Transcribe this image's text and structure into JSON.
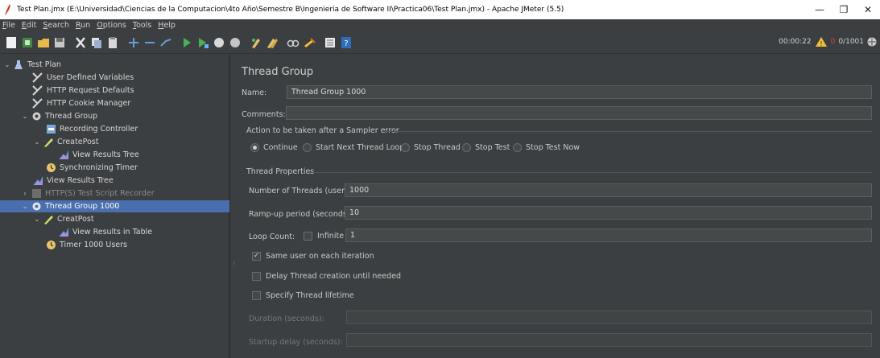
{
  "window": {
    "title": "Test Plan.jmx (E:\\Universidad\\Ciencias de la Computacion\\4to Año\\Semestre B\\Ingenieria de Software II\\Practica06\\Test Plan.jmx) - Apache JMeter (5.5)",
    "minimize": "—",
    "maximize": "❐",
    "close": "✕"
  },
  "menu": {
    "items": [
      {
        "u": "F",
        "rest": "ile"
      },
      {
        "u": "E",
        "rest": "dit"
      },
      {
        "u": "S",
        "rest": "earch"
      },
      {
        "u": "R",
        "rest": "un"
      },
      {
        "u": "O",
        "rest": "ptions"
      },
      {
        "u": "T",
        "rest": "ools"
      },
      {
        "u": "H",
        "rest": "elp"
      }
    ]
  },
  "status": {
    "elapsed": "00:00:22",
    "errors": "0",
    "threads": "0/1001",
    "warn_color": "#f2c037",
    "error_color": "#e04040"
  },
  "tree": {
    "nodes": [
      {
        "label": "Test Plan",
        "icon": "flask-icon"
      },
      {
        "label": "User Defined Variables",
        "icon": "wrench-icon"
      },
      {
        "label": "HTTP Request Defaults",
        "icon": "wrench-icon"
      },
      {
        "label": "HTTP Cookie Manager",
        "icon": "wrench-icon"
      },
      {
        "label": "Thread Group",
        "icon": "gear-icon"
      },
      {
        "label": "Recording Controller",
        "icon": "controller-icon"
      },
      {
        "label": "CreatePost",
        "icon": "pencil-icon"
      },
      {
        "label": "View Results Tree",
        "icon": "graph-icon"
      },
      {
        "label": "Synchronizing Timer",
        "icon": "timer-icon"
      },
      {
        "label": "View Results Tree",
        "icon": "graph-icon"
      },
      {
        "label": "HTTP(S) Test Script Recorder",
        "icon": "recorder-icon"
      },
      {
        "label": "Thread Group 1000",
        "icon": "gear-icon"
      },
      {
        "label": "CreatPost",
        "icon": "pencil-icon"
      },
      {
        "label": "View Results in Table",
        "icon": "graph-icon"
      },
      {
        "label": "Timer 1000 Users",
        "icon": "timer-icon"
      }
    ],
    "selected_color": "#4b6eaf"
  },
  "panel": {
    "title": "Thread Group",
    "name_label": "Name:",
    "name_value": "Thread Group 1000",
    "comments_label": "Comments:",
    "comments_value": "",
    "sampler_error": {
      "title": "Action to be taken after a Sampler error",
      "options": [
        "Continue",
        "Start Next Thread Loop",
        "Stop Thread",
        "Stop Test",
        "Stop Test Now"
      ],
      "selected": "Continue"
    },
    "thread_props": {
      "title": "Thread Properties",
      "num_threads_label": "Number of Threads (users):",
      "num_threads_value": "1000",
      "rampup_label": "Ramp-up period (seconds):",
      "rampup_value": "10",
      "loop_label": "Loop Count:",
      "infinite_label": "Infinite",
      "loop_value": "1",
      "same_user_label": "Same user on each iteration",
      "delay_label": "Delay Thread creation until needed",
      "lifetime_label": "Specify Thread lifetime",
      "duration_label": "Duration (seconds):",
      "startup_label": "Startup delay (seconds):"
    }
  }
}
